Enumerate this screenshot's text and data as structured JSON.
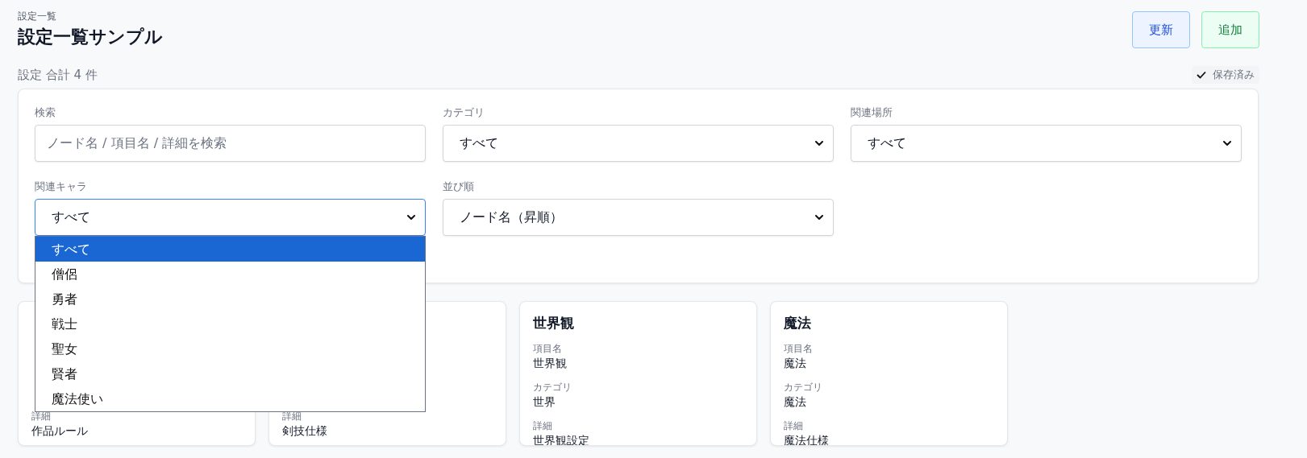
{
  "header": {
    "breadcrumb": "設定一覧",
    "title": "設定一覧サンプル",
    "buttons": [
      {
        "label": "更新",
        "kind": "refresh"
      },
      {
        "label": "追加",
        "kind": "add"
      }
    ]
  },
  "summary": {
    "count_text": "設定 合計 4 件",
    "status": {
      "text": "保存済み",
      "saved": true
    }
  },
  "filters": [
    {
      "kind": "text",
      "label": "検索",
      "placeholder": "ノード名 / 項目名 / 詳細を検索"
    },
    {
      "kind": "select",
      "label": "カテゴリ",
      "value": "すべて",
      "open": false
    },
    {
      "kind": "select",
      "label": "関連場所",
      "value": "すべて",
      "open": false
    },
    {
      "kind": "select",
      "label": "関連キャラ",
      "value": "すべて",
      "open": true,
      "options": [
        {
          "label": "すべて",
          "selected": true
        },
        {
          "label": "僧侶",
          "selected": false
        },
        {
          "label": "勇者",
          "selected": false
        },
        {
          "label": "戦士",
          "selected": false
        },
        {
          "label": "聖女",
          "selected": false
        },
        {
          "label": "賢者",
          "selected": false
        },
        {
          "label": "魔法使い",
          "selected": false
        }
      ]
    },
    {
      "kind": "select",
      "label": "並び順",
      "value": "ノード名（昇順）",
      "open": false
    }
  ],
  "cards": [
    {
      "fields": [
        {
          "label": "詳細",
          "value": "作品ルール"
        }
      ]
    },
    {
      "fields": [
        {
          "label": "詳細",
          "value": "剣技仕様"
        }
      ]
    },
    {
      "title": "世界観",
      "fields": [
        {
          "label": "項目名",
          "value": "世界観"
        },
        {
          "label": "カテゴリ",
          "value": "世界"
        },
        {
          "label": "詳細",
          "value": "世界観設定"
        }
      ]
    },
    {
      "title": "魔法",
      "fields": [
        {
          "label": "項目名",
          "value": "魔法"
        },
        {
          "label": "カテゴリ",
          "value": "魔法"
        },
        {
          "label": "詳細",
          "value": "魔法仕様"
        }
      ]
    }
  ]
}
